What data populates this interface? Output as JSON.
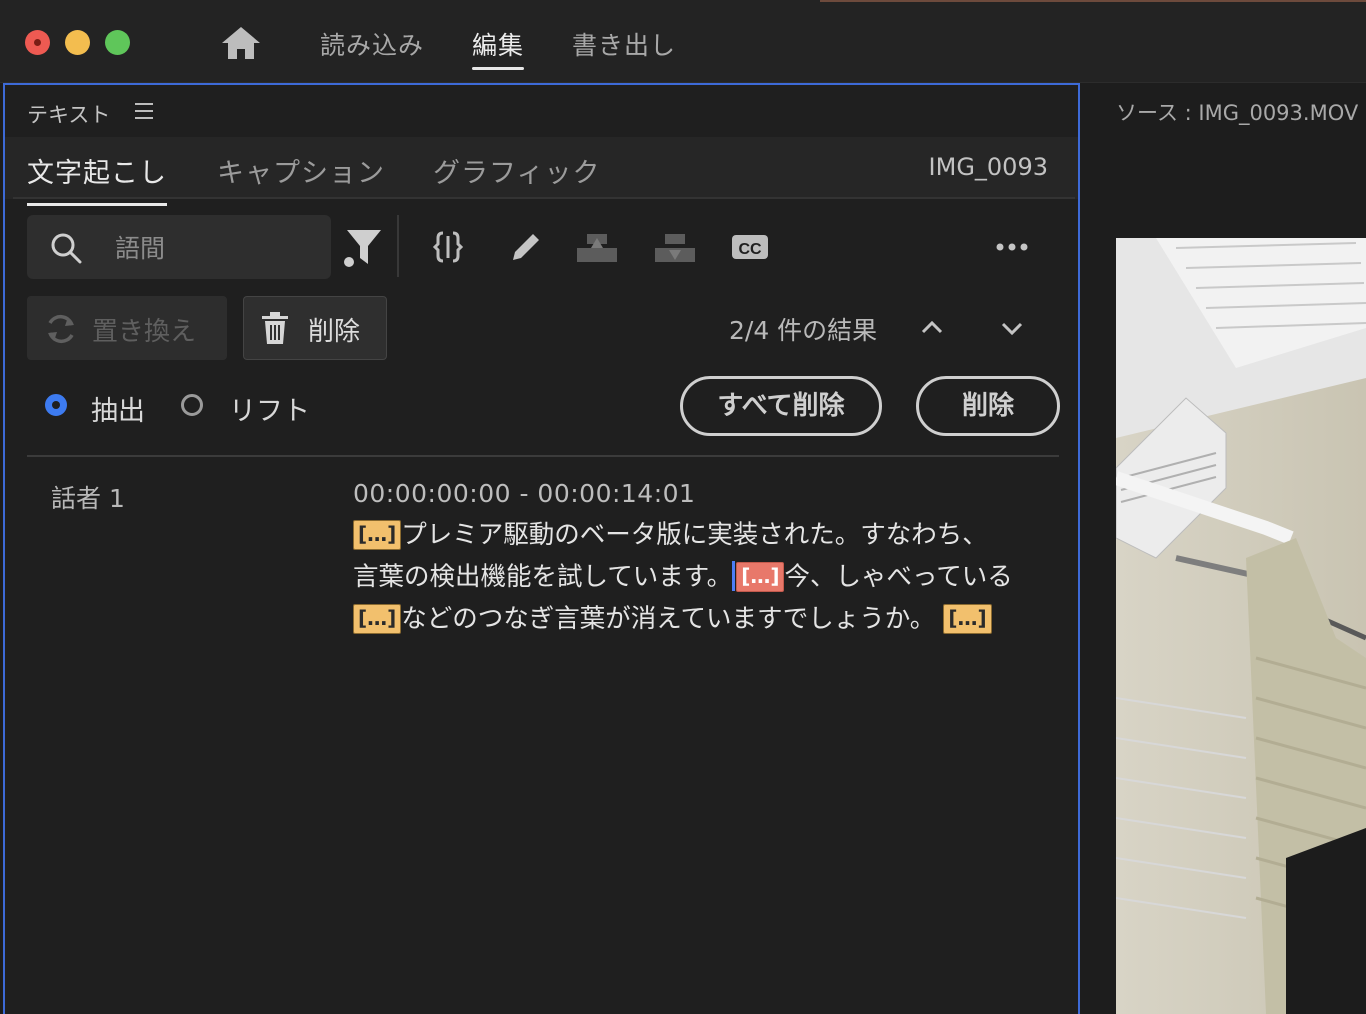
{
  "window": {
    "nav": {
      "import": "読み込み",
      "edit": "編集",
      "export": "書き出し"
    }
  },
  "panel": {
    "title": "テキスト",
    "tabs": {
      "transcript": "文字起こし",
      "captions": "キャプション",
      "graphics": "グラフィック"
    },
    "clip_name": "IMG_0093",
    "search": {
      "placeholder": "語間"
    },
    "buttons": {
      "replace": "置き換え",
      "delete": "削除"
    },
    "results": "2/4 件の結果",
    "options": {
      "extract": "抽出",
      "lift": "リフト",
      "extract_selected": true
    },
    "actions": {
      "delete_all": "すべて削除",
      "delete": "削除"
    }
  },
  "transcript": {
    "speaker": "話者 1",
    "timecode": "00:00:00:00 - 00:00:14:01",
    "pause_tag": "[…]",
    "segments": [
      "プレミア駆動のベータ版に実装された。すなわち、言葉の検出機能を試しています。",
      "今、しゃべっている",
      "などのつなぎ言葉が消えていますでしょうか。"
    ]
  },
  "monitor": {
    "source_label": "ソース : IMG_0093.MOV"
  },
  "colors": {
    "accent": "#3d7bf0",
    "pause_tag": "#f2c06d",
    "pause_tag_selected": "#e8786a"
  }
}
